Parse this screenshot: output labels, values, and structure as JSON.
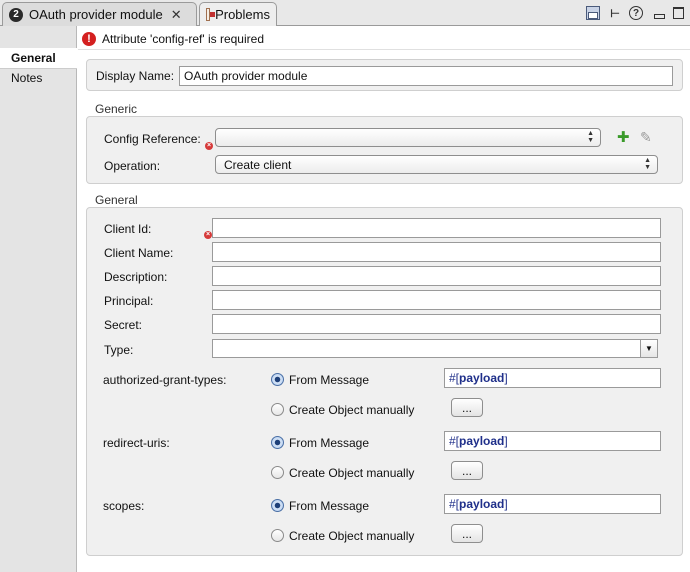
{
  "tabs": [
    {
      "badge": "2",
      "label": "OAuth provider module",
      "close": "✕"
    },
    {
      "label": "Problems"
    }
  ],
  "nav": [
    "General",
    "Notes"
  ],
  "error": "Attribute 'config-ref' is required",
  "display_name": {
    "label": "Display Name:",
    "value": "OAuth provider module"
  },
  "generic": {
    "title": "Generic",
    "config_reference": {
      "label": "Config Reference:",
      "value": ""
    },
    "operation": {
      "label": "Operation:",
      "value": "Create client"
    }
  },
  "general": {
    "title": "General",
    "fields": [
      {
        "label": "Client Id:",
        "value": "",
        "required": true
      },
      {
        "label": "Client Name:",
        "value": ""
      },
      {
        "label": "Description:",
        "value": ""
      },
      {
        "label": "Principal:",
        "value": ""
      },
      {
        "label": "Secret:",
        "value": ""
      }
    ],
    "type": {
      "label": "Type:",
      "value": ""
    },
    "groups": [
      {
        "label": "authorized-grant-types:",
        "opt_from": "From Message",
        "opt_manual": "Create Object manually",
        "expr_prefix": "#[",
        "expr_keyword": "payload",
        "expr_suffix": "]",
        "button": "..."
      },
      {
        "label": "redirect-uris:",
        "opt_from": "From Message",
        "opt_manual": "Create Object manually",
        "expr_prefix": "#[",
        "expr_keyword": "payload",
        "expr_suffix": "]",
        "button": "..."
      },
      {
        "label": "scopes:",
        "opt_from": "From Message",
        "opt_manual": "Create Object manually",
        "expr_prefix": "#[",
        "expr_keyword": "payload",
        "expr_suffix": "]",
        "button": "..."
      }
    ]
  },
  "icons": {
    "save": "save-icon",
    "outline": "outline-icon",
    "help": "help-icon",
    "add": "add-icon",
    "edit": "edit-icon",
    "error": "error-icon",
    "required": "required-marker-icon"
  },
  "glyphs": {
    "help": "?",
    "outline": "⊢",
    "error": "!",
    "required": "×",
    "plus": "✚",
    "edit": "✎",
    "updown": "▲▼",
    "down": "▼"
  }
}
